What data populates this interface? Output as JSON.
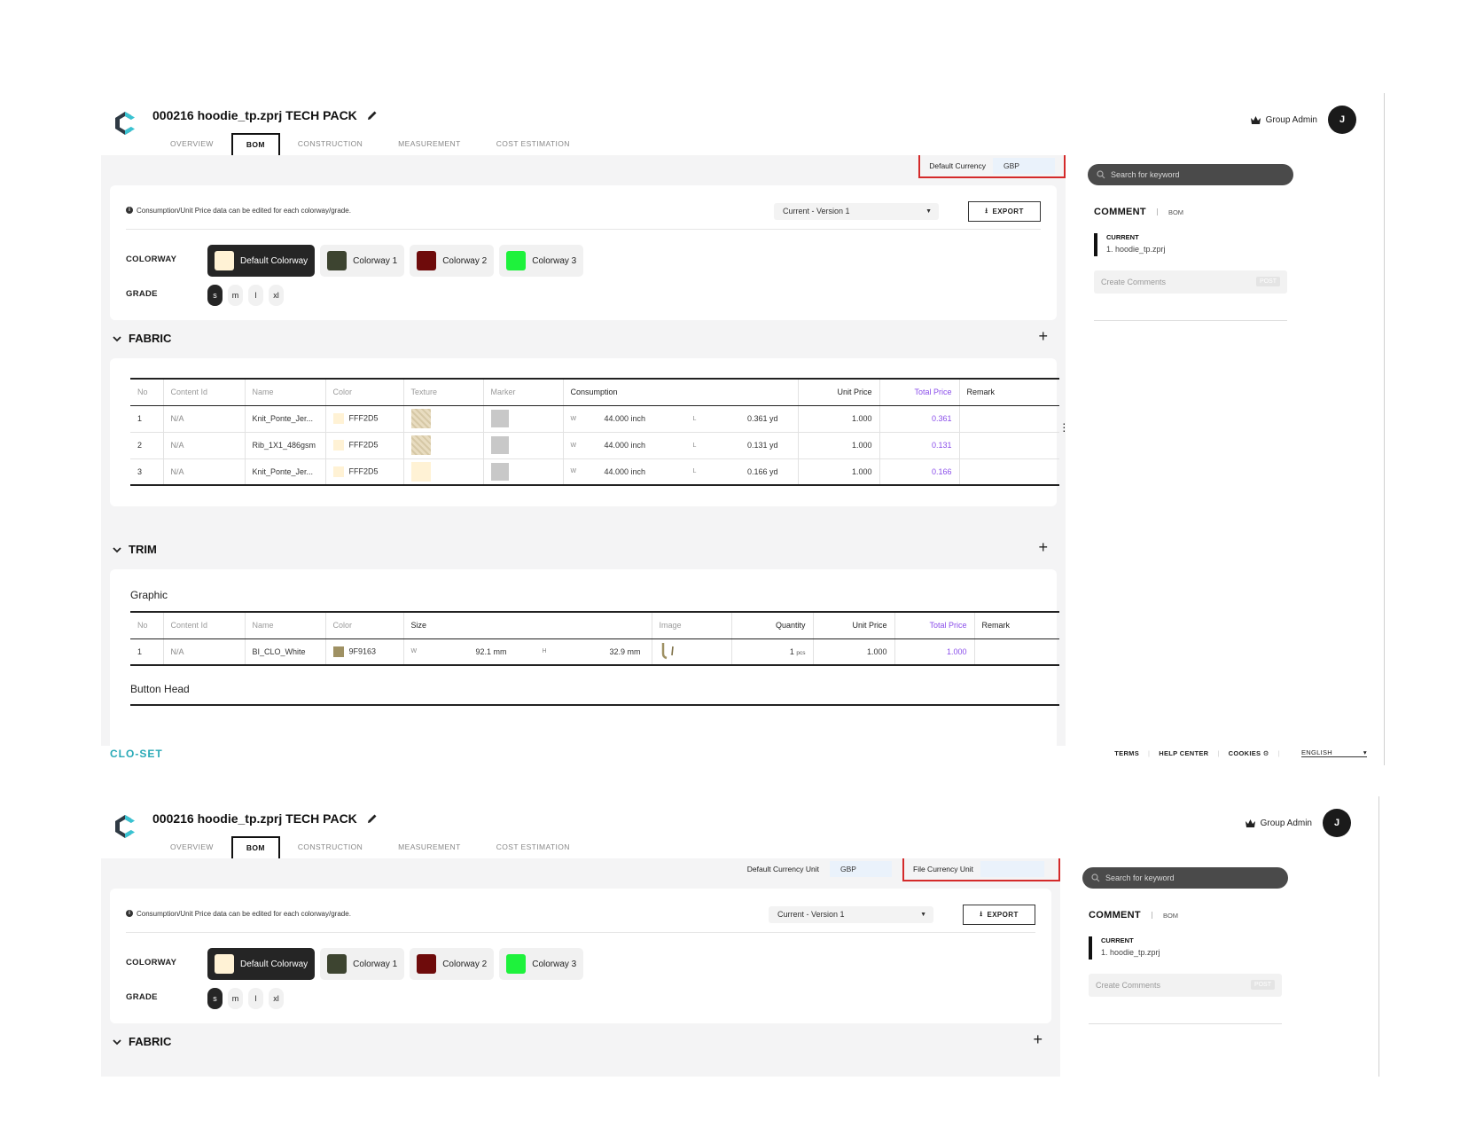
{
  "header": {
    "title": "000216 hoodie_tp.zprj TECH PACK",
    "tabs": [
      "OVERVIEW",
      "BOM",
      "CONSTRUCTION",
      "MEASUREMENT",
      "COST ESTIMATION"
    ],
    "user_role": "Group Admin",
    "avatar_letter": "J"
  },
  "currency": {
    "top_label": "Default Currency",
    "bottom_label": "Default Currency Unit",
    "value": "GBP",
    "file_label": "File Currency Unit",
    "file_value": ""
  },
  "bom": {
    "info": "Consumption/Unit Price data can be edited for each colorway/grade.",
    "version": "Current - Version 1",
    "export": "EXPORT",
    "colorway_label": "COLORWAY",
    "colorways": [
      {
        "name": "Default Colorway",
        "color": "#FFF2D5"
      },
      {
        "name": "Colorway 1",
        "color": "#3d4430"
      },
      {
        "name": "Colorway 2",
        "color": "#6e0b0b"
      },
      {
        "name": "Colorway 3",
        "color": "#1ef23c"
      }
    ],
    "grade_label": "GRADE",
    "grades": [
      "s",
      "m",
      "l",
      "xl"
    ]
  },
  "fabric": {
    "title": "FABRIC",
    "columns": [
      "No",
      "Content Id",
      "Name",
      "Color",
      "Texture",
      "Marker",
      "Consumption",
      "Unit Price",
      "Total Price",
      "Remark"
    ],
    "rows": [
      {
        "no": "1",
        "content_id": "N/A",
        "name": "Knit_Ponte_Jer...",
        "color": "FFF2D5",
        "w_label": "W",
        "w": "44.000 inch",
        "l_label": "L",
        "l": "0.361 yd",
        "unit_price": "1.000",
        "total_price": "0.361",
        "remark": ""
      },
      {
        "no": "2",
        "content_id": "N/A",
        "name": "Rib_1X1_486gsm",
        "color": "FFF2D5",
        "w_label": "W",
        "w": "44.000 inch",
        "l_label": "L",
        "l": "0.131 yd",
        "unit_price": "1.000",
        "total_price": "0.131",
        "remark": ""
      },
      {
        "no": "3",
        "content_id": "N/A",
        "name": "Knit_Ponte_Jer...",
        "color": "FFF2D5",
        "w_label": "W",
        "w": "44.000 inch",
        "l_label": "L",
        "l": "0.166 yd",
        "unit_price": "1.000",
        "total_price": "0.166",
        "remark": ""
      }
    ]
  },
  "trim": {
    "title": "TRIM",
    "graphic_title": "Graphic",
    "columns": [
      "No",
      "Content Id",
      "Name",
      "Color",
      "Size",
      "Image",
      "Quantity",
      "Unit Price",
      "Total Price",
      "Remark"
    ],
    "rows": [
      {
        "no": "1",
        "content_id": "N/A",
        "name": "BI_CLO_White",
        "color": "9F9163",
        "w_label": "W",
        "w": "92.1 mm",
        "h_label": "H",
        "h": "32.9 mm",
        "quantity": "1",
        "quantity_unit": "pcs",
        "unit_price": "1.000",
        "total_price": "1.000",
        "remark": ""
      }
    ],
    "button_head_title": "Button Head"
  },
  "sidebar": {
    "search_placeholder": "Search for keyword",
    "comment_title": "COMMENT",
    "comment_scope": "BOM",
    "current_label": "CURRENT",
    "current_file": "1. hoodie_tp.zprj",
    "create_placeholder": "Create Comments",
    "post": "POST"
  },
  "footer": {
    "logo": "CLO-SET",
    "links": [
      "TERMS",
      "HELP CENTER",
      "COOKIES"
    ],
    "language": "ENGLISH"
  },
  "colors": {
    "accent_purple": "#8a4dea",
    "highlight_red": "#d42a2a",
    "logo_teal": "#2aaab7"
  }
}
